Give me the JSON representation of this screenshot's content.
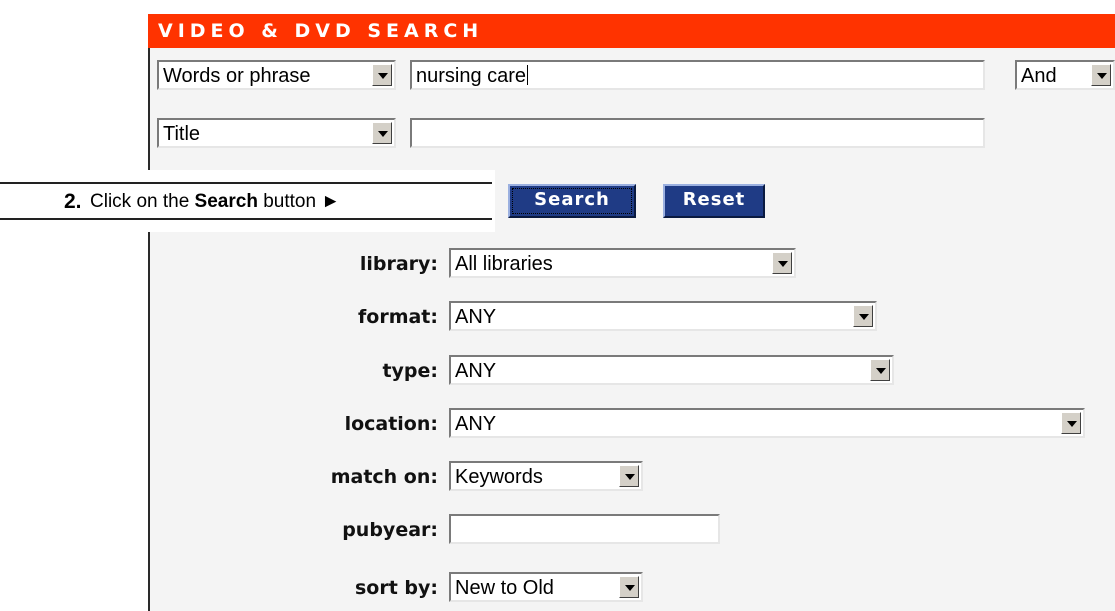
{
  "header": {
    "title": "VIDEO & DVD SEARCH"
  },
  "search_rows": [
    {
      "field_select": "Words or phrase",
      "query": "nursing care",
      "operator": "And"
    },
    {
      "field_select": "Title",
      "query": ""
    }
  ],
  "buttons": {
    "search": "Search",
    "reset": "Reset"
  },
  "callout": {
    "step": "2.",
    "prefix": "Click on the ",
    "emphasis": "Search",
    "suffix": " button ►"
  },
  "filters": {
    "library": {
      "label": "library:",
      "value": "All libraries"
    },
    "format": {
      "label": "format:",
      "value": "ANY"
    },
    "type": {
      "label": "type:",
      "value": "ANY"
    },
    "location": {
      "label": "location:",
      "value": "ANY"
    },
    "match_on": {
      "label": "match on:",
      "value": "Keywords"
    },
    "pubyear": {
      "label": "pubyear:",
      "value": ""
    },
    "sort_by": {
      "label": "sort by:",
      "value": "New to Old"
    }
  },
  "colors": {
    "header_bg": "#ff3300",
    "button_bg": "#1f3b85",
    "panel_bg": "#f4f4f4"
  }
}
